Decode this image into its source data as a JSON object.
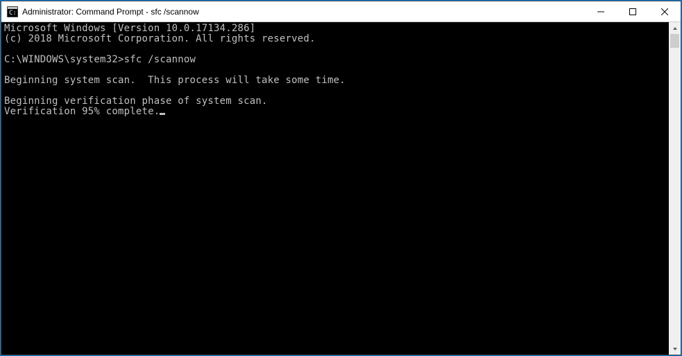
{
  "window": {
    "title": "Administrator: Command Prompt - sfc  /scannow"
  },
  "console": {
    "line1": "Microsoft Windows [Version 10.0.17134.286]",
    "line2": "(c) 2018 Microsoft Corporation. All rights reserved.",
    "blank1": "",
    "prompt_path": "C:\\WINDOWS\\system32>",
    "command": "sfc /scannow",
    "blank2": "",
    "line_scan": "Beginning system scan.  This process will take some time.",
    "blank3": "",
    "line_verify1": "Beginning verification phase of system scan.",
    "line_verify2": "Verification 95% complete."
  }
}
